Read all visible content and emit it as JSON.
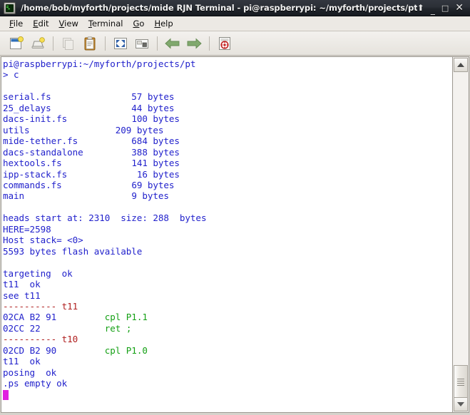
{
  "window": {
    "icon": "terminal-icon",
    "title": "/home/bob/myforth/projects/mide RJN Terminal - pi@raspberrypi: ~/myforth/projects/pt",
    "controls": {
      "shade": "⬆",
      "minimize": "_",
      "maximize": "□",
      "close": "✕"
    }
  },
  "menubar": {
    "items": [
      {
        "label": "File",
        "mnemonic": "F",
        "rest": "ile"
      },
      {
        "label": "Edit",
        "mnemonic": "E",
        "rest": "dit"
      },
      {
        "label": "View",
        "mnemonic": "V",
        "rest": "iew"
      },
      {
        "label": "Terminal",
        "mnemonic": "T",
        "rest": "erminal"
      },
      {
        "label": "Go",
        "mnemonic": "G",
        "rest": "o"
      },
      {
        "label": "Help",
        "mnemonic": "H",
        "rest": "elp"
      }
    ]
  },
  "toolbar": {
    "buttons": [
      {
        "name": "new-tab-icon",
        "label": "New Tab",
        "disabled": false
      },
      {
        "name": "new-window-icon",
        "label": "New Window",
        "disabled": false
      },
      {
        "name": "copy-icon",
        "label": "Copy",
        "disabled": true
      },
      {
        "name": "paste-icon",
        "label": "Paste",
        "disabled": false
      },
      {
        "name": "fullscreen-icon",
        "label": "Full Screen",
        "disabled": false
      },
      {
        "name": "reset-icon",
        "label": "Reset",
        "disabled": false
      },
      {
        "name": "back-arrow-icon",
        "label": "Previous Tab",
        "disabled": false
      },
      {
        "name": "forward-arrow-icon",
        "label": "Next Tab",
        "disabled": false
      },
      {
        "name": "help-icon",
        "label": "Contents",
        "disabled": false
      }
    ]
  },
  "terminal": {
    "colors": {
      "background": "#ffffff",
      "foreground": "#2222cc",
      "green": "#14a014",
      "red": "#b02020",
      "cursor": "#e020e0"
    },
    "prompt": "pi@raspberrypi:~/myforth/projects/pt",
    "command": "> c",
    "file_listing": [
      {
        "name": "serial.fs",
        "size": "57",
        "unit": "bytes"
      },
      {
        "name": "25_delays",
        "size": "44",
        "unit": "bytes"
      },
      {
        "name": "dacs-init.fs",
        "size": "100",
        "unit": "bytes"
      },
      {
        "name": "utils",
        "size": "209",
        "unit": "bytes"
      },
      {
        "name": "mide-tether.fs",
        "size": "684",
        "unit": "bytes"
      },
      {
        "name": "dacs-standalone",
        "size": "388",
        "unit": "bytes"
      },
      {
        "name": "hextools.fs",
        "size": "141",
        "unit": "bytes"
      },
      {
        "name": "ipp-stack.fs",
        "size": "16",
        "unit": "bytes"
      },
      {
        "name": "commands.fs",
        "size": "69",
        "unit": "bytes"
      },
      {
        "name": "main",
        "size": "9",
        "unit": "bytes"
      }
    ],
    "memory_report": [
      "heads start at: 2310  size: 288  bytes",
      "HERE=2598",
      "Host stack= <0>",
      "5593 bytes flash available"
    ],
    "session": [
      {
        "text": "targeting  ok",
        "color": "blue"
      },
      {
        "text": "t11  ok",
        "color": "blue"
      },
      {
        "text": "see t11",
        "color": "blue"
      }
    ],
    "disassembly": [
      {
        "kind": "header",
        "dashes": "----------",
        "label": "t11"
      },
      {
        "kind": "code",
        "address": "02CA",
        "bytes": "B2 91",
        "mnemonic": "cpl P1.1"
      },
      {
        "kind": "code",
        "address": "02CC",
        "bytes": "22",
        "mnemonic": "ret ;"
      },
      {
        "kind": "header",
        "dashes": "----------",
        "label": "t10"
      },
      {
        "kind": "code",
        "address": "02CD",
        "bytes": "B2 90",
        "mnemonic": "cpl P1.0"
      }
    ],
    "trailing": [
      "t11  ok",
      "posing  ok",
      ".ps empty ok"
    ]
  },
  "scrollbar": {
    "up_arrow": "scroll-up-arrow",
    "down_arrow": "scroll-down-arrow",
    "thumb": "scroll-thumb"
  }
}
